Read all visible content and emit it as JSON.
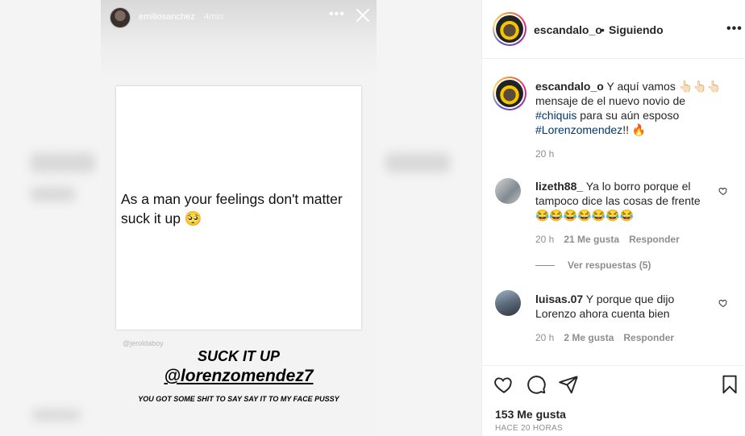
{
  "story": {
    "username": "emiliosanchez",
    "time": "4min",
    "quote": "As a man your feelings don't matter suck it up",
    "quote_emoji": "🥺",
    "watermark": "@jeroldaboy",
    "headline": "SUCK IT UP",
    "handle": "@lorenzomendez7",
    "subline": "YOU GOT SOME SHIT TO SAY SAY IT TO MY FACE PUSSY"
  },
  "post": {
    "author": "escandalo_o",
    "separator": "•",
    "follow_label": "Siguiendo",
    "more_icon": "more-horizontal-icon",
    "caption": {
      "username": "escandalo_o",
      "text_a": "Y aquí vamos 👆🏻👆🏻👆🏻 mensaje de el nuevo novio de",
      "hashtag_1": "#chiquis",
      "text_b": "para su aún esposo",
      "hashtag_2": "#Lorenzomendez",
      "text_c": "!! 🔥",
      "time": "20 h"
    },
    "comments": [
      {
        "username": "lizeth88_",
        "text": "Ya lo borro porque el tampoco dice las cosas de frente",
        "emojis": "😂😂😂😂😂😂😂",
        "time": "20 h",
        "likes": "21 Me gusta",
        "reply": "Responder",
        "view_replies": "Ver respuestas (5)"
      },
      {
        "username": "luisas.07",
        "text": "Y porque que dijo Lorenzo ahora cuenta bien",
        "time": "20 h",
        "likes": "2 Me gusta",
        "reply": "Responder"
      }
    ],
    "likes_count": "153 Me gusta",
    "posted": "HACE 20 HORAS",
    "action_icons": [
      "heart-icon",
      "comment-icon",
      "share-icon",
      "bookmark-icon"
    ]
  }
}
